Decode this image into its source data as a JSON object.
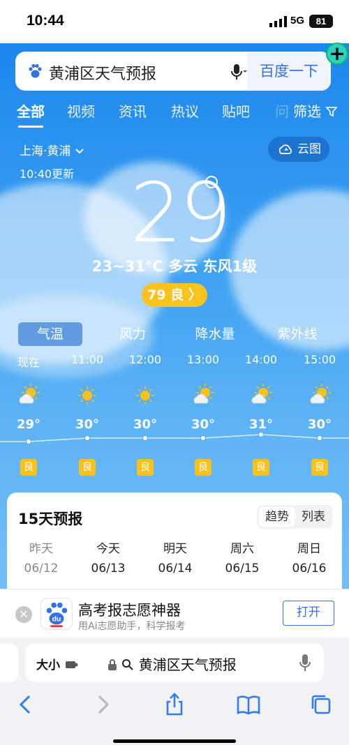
{
  "status": {
    "time": "10:44",
    "network": "5G",
    "battery": "81"
  },
  "search": {
    "query": "黄浦区天气预报",
    "button": "百度一下"
  },
  "tabs": [
    "全部",
    "视频",
    "资讯",
    "热议",
    "贴吧",
    "问"
  ],
  "filter_label": "筛选",
  "location": {
    "name": "上海·黄浦",
    "updated": "10:40更新",
    "cloud_map": "云图"
  },
  "current": {
    "temp": "29",
    "summary": "23~31°C  多云  东风1级",
    "aqi": "79 良 〉"
  },
  "chart_tabs": [
    "气温",
    "风力",
    "降水量",
    "紫外线"
  ],
  "hourly": [
    {
      "time": "现在",
      "temp": "29°",
      "icon": "partly-cloudy-icon",
      "air": "良",
      "value": 29
    },
    {
      "time": "11:00",
      "temp": "30°",
      "icon": "sun-icon",
      "air": "良",
      "value": 30
    },
    {
      "time": "12:00",
      "temp": "30°",
      "icon": "sun-icon",
      "air": "良",
      "value": 30
    },
    {
      "time": "13:00",
      "temp": "30°",
      "icon": "partly-cloudy-icon",
      "air": "良",
      "value": 30
    },
    {
      "time": "14:00",
      "temp": "31°",
      "icon": "partly-cloudy-icon",
      "air": "良",
      "value": 31
    },
    {
      "time": "15:00",
      "temp": "30°",
      "icon": "partly-cloudy-icon",
      "air": "良",
      "value": 30
    }
  ],
  "forecast": {
    "title": "15天预报",
    "view_trend": "趋势",
    "view_list": "列表",
    "days": [
      {
        "name": "昨天",
        "date": "06/12"
      },
      {
        "name": "今天",
        "date": "06/13"
      },
      {
        "name": "明天",
        "date": "06/14"
      },
      {
        "name": "周六",
        "date": "06/15"
      },
      {
        "name": "周日",
        "date": "06/16"
      }
    ]
  },
  "promo": {
    "title": "高考报志愿神器",
    "subtitle": "用Ai志愿助手，科学报考",
    "button": "打开"
  },
  "browser": {
    "text_size": "大小",
    "url": "黄浦区天气预报"
  },
  "colors": {
    "accent": "#3670e6",
    "air_good": "#f9c21a",
    "sky": "#2f8cf0"
  }
}
